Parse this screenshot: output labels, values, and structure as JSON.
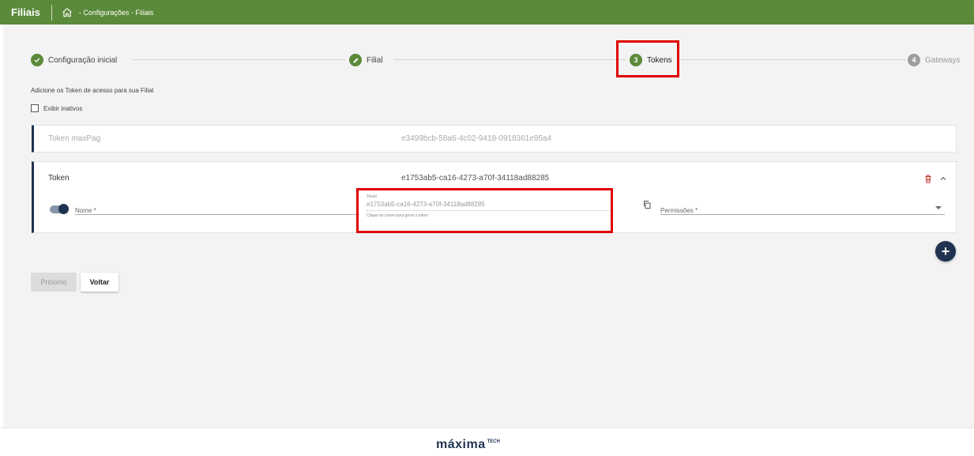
{
  "header": {
    "title": "Filiais",
    "breadcrumb": "- Configurações - Filiais",
    "background": "#5b8a3a",
    "home_icon": "home-icon"
  },
  "stepper": {
    "steps": [
      {
        "label": "Configuração inicial",
        "state": "completed",
        "icon": "check-icon",
        "color": "#5b8a3a"
      },
      {
        "label": "Filial",
        "state": "editing",
        "icon": "pencil-icon",
        "color": "#5b8a3a"
      },
      {
        "number": "3",
        "label": "Tokens",
        "state": "active",
        "color": "#5b8a3a"
      },
      {
        "number": "4",
        "label": "Gateways",
        "state": "pending",
        "color": "#9e9e9e"
      }
    ]
  },
  "intro_text": "Adicione os Token de acesso para sua Filial",
  "show_inactive": {
    "label": "Exibir inativos",
    "checked": false
  },
  "tokens": [
    {
      "title": "Token maxPag",
      "value": "e3499bcb-58a6-4c02-9418-0918361e95a4",
      "collapsed": true
    },
    {
      "title": "Token",
      "value": "e1753ab5-ca16-4273-a70f-34118ad88285",
      "collapsed": false,
      "active": true,
      "nome_placeholder": "Nome *",
      "token_field_label": "Token",
      "token_field_value": "e1753ab5-ca16-4273-a70f-34118ad88285",
      "token_field_hint": "Clique na chave para gerar o token",
      "permissions_placeholder": "Permissões *"
    }
  ],
  "fab": {
    "label": "+",
    "icon": "plus-icon"
  },
  "buttons": {
    "next": "Próximo",
    "back": "Voltar"
  },
  "footer": {
    "brand": "máxima",
    "brand_suffix": "TECH"
  },
  "colors": {
    "accent": "#5b8a3a",
    "navy": "#1f3350",
    "highlight": "#e00000",
    "danger": "#c0392b"
  }
}
